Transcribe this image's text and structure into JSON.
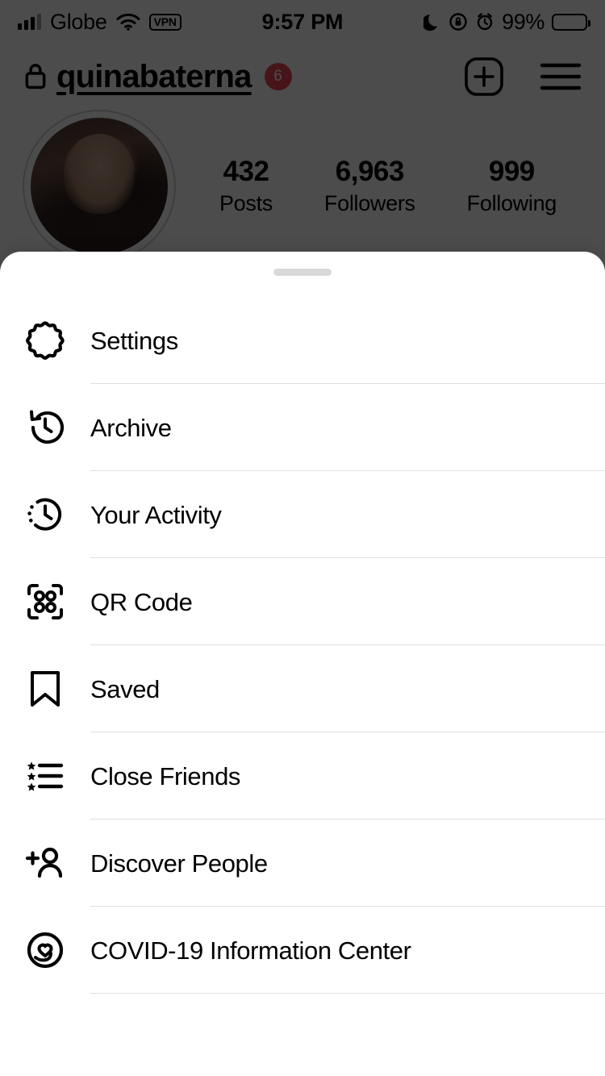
{
  "status_bar": {
    "carrier": "Globe",
    "wifi_icon": "wifi-icon",
    "vpn_label": "VPN",
    "time": "9:57 PM",
    "do_not_disturb_icon": "moon-icon",
    "rotation_lock_icon": "rotation-lock-icon",
    "alarm_icon": "alarm-icon",
    "battery_percent": "99%"
  },
  "profile": {
    "privacy_icon": "lock-icon",
    "username": "quinabaterna",
    "notification_badge": "6",
    "new_post_icon": "plus-square-icon",
    "menu_icon": "hamburger-menu-icon",
    "avatar_name": "profile-avatar",
    "stats": [
      {
        "value": "432",
        "label": "Posts"
      },
      {
        "value": "6,963",
        "label": "Followers"
      },
      {
        "value": "999",
        "label": "Following"
      }
    ]
  },
  "sheet": {
    "grabber": "sheet-grabber",
    "items": [
      {
        "id": "settings",
        "label": "Settings",
        "icon": "gear-icon"
      },
      {
        "id": "archive",
        "label": "Archive",
        "icon": "clock-back-arrow-icon"
      },
      {
        "id": "your-activity",
        "label": "Your Activity",
        "icon": "clock-dotted-icon"
      },
      {
        "id": "qr-code",
        "label": "QR Code",
        "icon": "qr-code-icon"
      },
      {
        "id": "saved",
        "label": "Saved",
        "icon": "bookmark-icon"
      },
      {
        "id": "close-friends",
        "label": "Close Friends",
        "icon": "star-list-icon"
      },
      {
        "id": "discover-people",
        "label": "Discover People",
        "icon": "person-plus-icon"
      },
      {
        "id": "covid-info",
        "label": "COVID-19 Information Center",
        "icon": "heart-circle-icon"
      }
    ]
  },
  "colors": {
    "badge_red": "#ED4956",
    "sheet_background": "#FFFFFF",
    "divider": "#DEDEDE",
    "grabber": "#D9D9D9",
    "scrim": "rgba(0,0,0,0.70)"
  }
}
